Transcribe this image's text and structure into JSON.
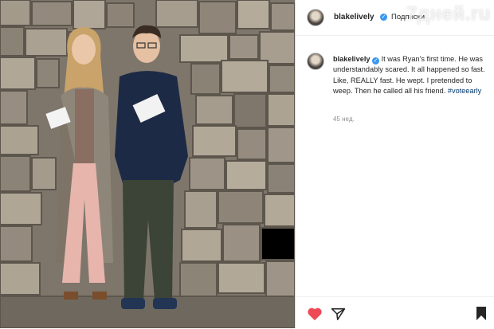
{
  "post": {
    "username": "blakelively",
    "follow_label": "Подписки",
    "caption_text": "It was Ryan's first time. He was understandably scared. It all happened so fast. Like, REALLY fast. He wept. I pretended to weep. Then he called all his friend.",
    "hashtag": "#voteearly",
    "timestamp": "45 нед."
  },
  "watermark": "7дней.ru",
  "icons": {
    "like": "heart-icon",
    "share": "paper-plane-icon",
    "save": "bookmark-icon",
    "verified": "verified-badge-icon"
  },
  "colors": {
    "like": "#ed4956",
    "verified": "#3897f0",
    "hashtag": "#00376b"
  }
}
